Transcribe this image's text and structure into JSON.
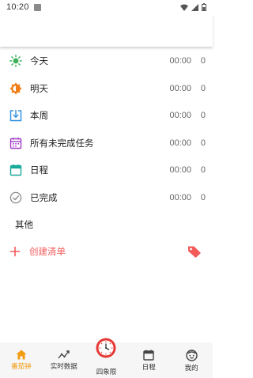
{
  "status_bar": {
    "time": "10:20"
  },
  "list": [
    {
      "label": "今天",
      "time": "00:00",
      "count": "0",
      "icon": "sun-icon",
      "color": "#3cb05a"
    },
    {
      "label": "明天",
      "time": "00:00",
      "count": "0",
      "icon": "half-sun-icon",
      "color": "#f07f1a"
    },
    {
      "label": "本周",
      "time": "00:00",
      "count": "0",
      "icon": "download-box-icon",
      "color": "#2e8fe0"
    },
    {
      "label": "所有未完成任务",
      "time": "00:00",
      "count": "0",
      "icon": "calendar-grid-icon",
      "color": "#a23ac4"
    },
    {
      "label": "日程",
      "time": "00:00",
      "count": "0",
      "icon": "calendar-icon",
      "color": "#1aa89a"
    },
    {
      "label": "已完成",
      "time": "00:00",
      "count": "0",
      "icon": "check-circle-icon",
      "color": "#8a8a8a"
    }
  ],
  "section_label": "其他",
  "create_list": {
    "label": "创建清单",
    "color": "#f35a5a"
  },
  "tabs": [
    {
      "label": "番茄钟",
      "active": true
    },
    {
      "label": "实时数据"
    },
    {
      "label": "四象限"
    },
    {
      "label": "日程"
    },
    {
      "label": "我的"
    }
  ],
  "accent": "#f39c12"
}
